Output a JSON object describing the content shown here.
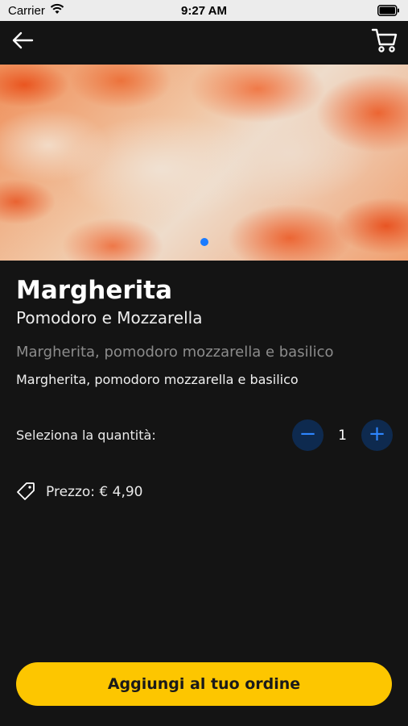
{
  "status_bar": {
    "carrier": "Carrier",
    "time": "9:27 AM"
  },
  "nav": {
    "back_icon": "arrow-left-icon",
    "cart_icon": "cart-icon"
  },
  "hero": {
    "image_subject": "pizza margherita close-up",
    "page_indicator": {
      "pages": 1,
      "active": 1,
      "color": "#1a7bff"
    }
  },
  "product": {
    "name": "Margherita",
    "subtitle": "Pomodoro e Mozzarella",
    "description_muted": "Margherita, pomodoro mozzarella e basilico",
    "description": "Margherita, pomodoro mozzarella e basilico"
  },
  "quantity": {
    "label": "Seleziona la quantità:",
    "value": "1",
    "minus_label": "−",
    "plus_label": "+"
  },
  "price": {
    "icon": "price-tag-icon",
    "label": "Prezzo:",
    "value": "€ 4,90"
  },
  "actions": {
    "add_to_order_label": "Aggiungi al tuo ordine"
  },
  "colors": {
    "background": "#141414",
    "accent_yellow": "#fdc600",
    "accent_blue": "#2e86ff",
    "stepper_background": "#0e2a4f"
  }
}
